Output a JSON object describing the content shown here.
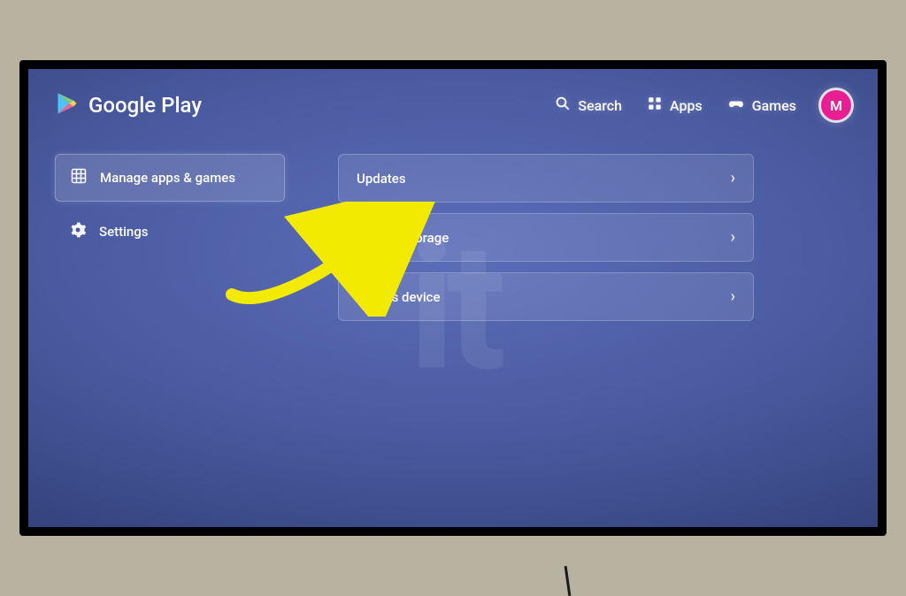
{
  "brand": {
    "name": "Google Play"
  },
  "nav": {
    "search": "Search",
    "apps": "Apps",
    "games": "Games",
    "avatar_initial": "M"
  },
  "sidebar": {
    "items": [
      {
        "label": "Manage apps & games",
        "selected": true
      },
      {
        "label": "Settings",
        "selected": false
      }
    ]
  },
  "watermark": "it",
  "main": {
    "cards": [
      {
        "label": "Updates"
      },
      {
        "label": "Free up storage"
      },
      {
        "label": "On this device"
      }
    ]
  }
}
